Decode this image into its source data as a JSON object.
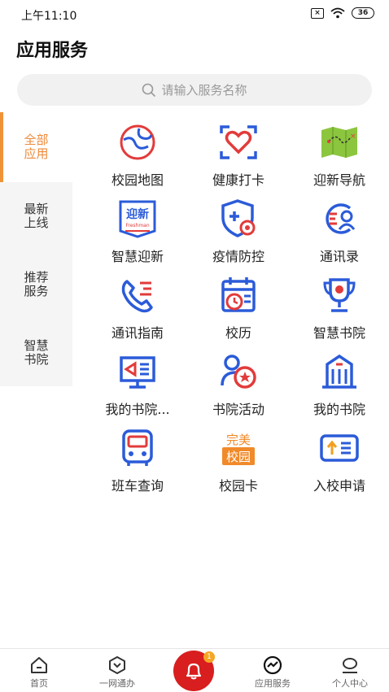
{
  "status": {
    "time": "上午11:10",
    "battery": "36"
  },
  "page_title": "应用服务",
  "search": {
    "placeholder": "请输入服务名称"
  },
  "sidebar": {
    "items": [
      {
        "line1": "全部",
        "line2": "应用"
      },
      {
        "line1": "最新",
        "line2": "上线"
      },
      {
        "line1": "推荐",
        "line2": "服务"
      },
      {
        "line1": "智慧",
        "line2": "书院"
      }
    ]
  },
  "services": [
    {
      "label": "校园地图",
      "icon": "campus-map-icon"
    },
    {
      "label": "健康打卡",
      "icon": "health-checkin-icon"
    },
    {
      "label": "迎新导航",
      "icon": "welcome-navigation-icon"
    },
    {
      "label": "智慧迎新",
      "icon": "smart-welcome-icon",
      "badge_text": "迎新",
      "badge_sub": "Freshman"
    },
    {
      "label": "疫情防控",
      "icon": "epidemic-control-icon"
    },
    {
      "label": "通讯录",
      "icon": "contacts-icon"
    },
    {
      "label": "通讯指南",
      "icon": "phone-guide-icon"
    },
    {
      "label": "校历",
      "icon": "calendar-icon"
    },
    {
      "label": "智慧书院",
      "icon": "trophy-icon"
    },
    {
      "label": "我的书院...",
      "icon": "display-icon"
    },
    {
      "label": "书院活动",
      "icon": "activity-icon"
    },
    {
      "label": "我的书院",
      "icon": "building-icon"
    },
    {
      "label": "班车查询",
      "icon": "bus-icon"
    },
    {
      "label": "校园卡",
      "icon": "campus-card-icon",
      "badge_text": "完美",
      "badge_sub": "校园"
    },
    {
      "label": "入校申请",
      "icon": "entry-application-icon"
    }
  ],
  "tabs": [
    {
      "label": "首页",
      "icon": "home-icon"
    },
    {
      "label": "一网通办",
      "icon": "one-stop-icon"
    },
    {
      "label": "",
      "icon": "bell-icon"
    },
    {
      "label": "应用服务",
      "icon": "app-service-icon"
    },
    {
      "label": "个人中心",
      "icon": "user-icon"
    }
  ],
  "notification_badge": "1",
  "colors": {
    "accent": "#f09238",
    "icon_blue": "#2b5bd9",
    "icon_red": "#e23b3b",
    "bell_red": "#d81e1e"
  }
}
